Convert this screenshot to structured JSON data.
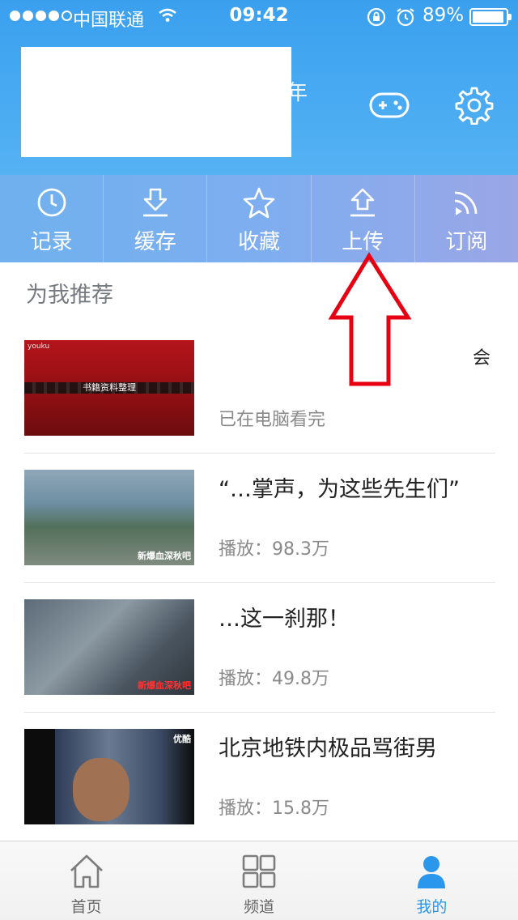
{
  "status_bar": {
    "carrier": "中国联通",
    "time": "09:42",
    "battery": "89%"
  },
  "header": {
    "year_text": "年",
    "icons": [
      "gamepad-icon",
      "gear-icon"
    ]
  },
  "quick_actions": [
    {
      "label": "记录",
      "icon": "clock-icon"
    },
    {
      "label": "缓存",
      "icon": "download-icon"
    },
    {
      "label": "收藏",
      "icon": "star-icon"
    },
    {
      "label": "上传",
      "icon": "upload-icon"
    },
    {
      "label": "订阅",
      "icon": "rss-icon"
    }
  ],
  "recommend": {
    "title": "为我推荐",
    "items": [
      {
        "title": "",
        "meta": "已在电脑看完",
        "thumb_caption": "书籍资料整理",
        "thumb_logo": "youku",
        "flag": "会"
      },
      {
        "title": "“…掌声，为这些先生们”",
        "meta": "播放：98.3万",
        "thumb_caption": "新爆血深秋吧"
      },
      {
        "title": "…这一刹那！",
        "meta": "播放：49.8万",
        "thumb_caption": "新爆血深秋吧"
      },
      {
        "title": "北京地铁内极品骂街男",
        "meta": "播放：15.8万",
        "thumb_caption": "优酷"
      }
    ]
  },
  "tabs": [
    {
      "label": "首页",
      "icon": "home-icon",
      "active": false
    },
    {
      "label": "频道",
      "icon": "grid-icon",
      "active": false
    },
    {
      "label": "我的",
      "icon": "person-icon",
      "active": true
    }
  ],
  "colors": {
    "header": "#3aa0ee",
    "accent": "#2a96ec",
    "annotation_arrow": "#e60012"
  }
}
